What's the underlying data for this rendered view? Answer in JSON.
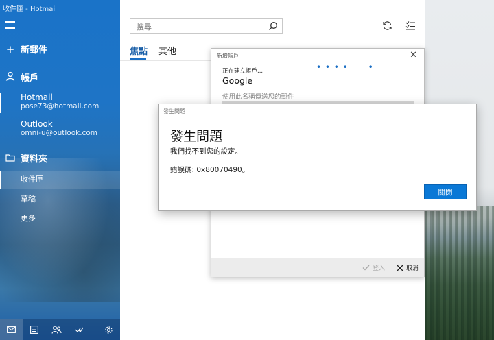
{
  "window": {
    "title": "收件匣 - Hotmail"
  },
  "sidebar": {
    "new_mail": "新郵件",
    "accounts_header": "帳戶",
    "accounts": [
      {
        "name": "Hotmail",
        "email": "pose73@hotmail.com"
      },
      {
        "name": "Outlook",
        "email": "omni-u@outlook.com"
      }
    ],
    "folders_header": "資料夾",
    "folders": [
      "收件匣",
      "草稿",
      "更多"
    ]
  },
  "list": {
    "search_placeholder": "搜尋",
    "tabs": [
      "焦點",
      "其他"
    ]
  },
  "add_account_dialog": {
    "title": "新增帳戶",
    "status": "正在建立帳戶...",
    "provider": "Google",
    "hint": "使用此名稱傳送您的郵件",
    "signin_label": "登入",
    "cancel_label": "取消"
  },
  "error_dialog": {
    "title": "發生問題",
    "heading": "發生問題",
    "message": "我們找不到您的設定。",
    "error_code": "錯誤碼: 0x80070490。",
    "close_label": "關閉"
  },
  "colors": {
    "accent": "#0a78d6",
    "sidebar": "#1e74c6"
  }
}
